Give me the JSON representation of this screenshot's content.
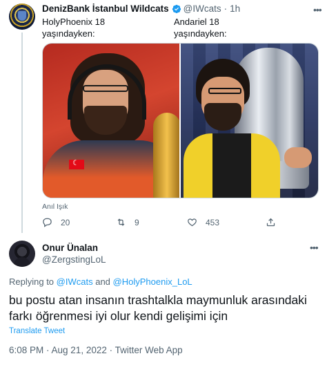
{
  "tweet1": {
    "author_name": "DenizBank İstanbul Wildcats",
    "handle": "@IWcats",
    "separator": "·",
    "time": "1h",
    "col_left": {
      "line1": "HolyPhoenix 18",
      "line2": "yaşındayken:"
    },
    "col_right": {
      "line1": "Andariel 18",
      "line2": "yaşındayken:"
    },
    "photo_caption": "Anıl Işık",
    "counts": {
      "replies": "20",
      "retweets": "9",
      "likes": "453"
    }
  },
  "tweet2": {
    "author_name": "Onur Ünalan",
    "handle": "@ZergstingLoL",
    "replying_prefix": "Replying to",
    "replying_to_1": "@IWcats",
    "replying_and": "and",
    "replying_to_2": "@HolyPhoenix_LoL",
    "text": "bu postu atan insanın trashtalkla maymunluk arasındaki farkı öğrenmesi iyi olur kendi gelişimi için",
    "translate_label": "Translate Tweet",
    "meta": "6:08 PM · Aug 21, 2022 · Twitter Web App"
  },
  "colors": {
    "link": "#1d9bf0",
    "secondary_text": "#536471",
    "verified": "#1d9bf0"
  },
  "icons": [
    "verified-icon",
    "more-icon",
    "reply-icon",
    "retweet-icon",
    "like-icon",
    "share-icon"
  ]
}
